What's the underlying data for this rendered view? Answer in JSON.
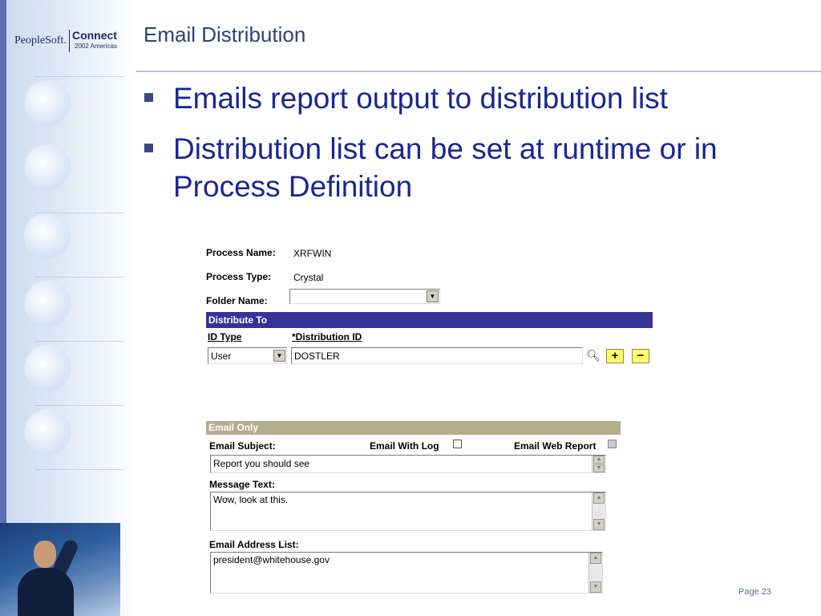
{
  "header": {
    "logo_brand": "PeopleSoft.",
    "logo_product": "Connect",
    "logo_sub": "2002 Americas",
    "title": "Email Distribution"
  },
  "bullets": [
    "Emails report output to distribution list",
    "Distribution list can be set at runtime or in Process Definition"
  ],
  "form": {
    "process_name_label": "Process Name:",
    "process_name_value": "XRFWIN",
    "process_type_label": "Process Type:",
    "process_type_value": "Crystal",
    "folder_name_label": "Folder Name:",
    "folder_name_value": "",
    "distribute_to": {
      "title": "Distribute To",
      "title_bg": "#333399",
      "col_id_type": "ID Type",
      "col_distribution_id": "*Distribution ID",
      "id_type_value": "User",
      "distribution_id_value": "DOSTLER",
      "add_label": "+",
      "remove_label": "−"
    },
    "email_only": {
      "title": "Email Only",
      "title_bg": "#b3ad8c",
      "email_subject_label": "Email Subject:",
      "email_with_log_label": "Email With Log",
      "email_with_log_checked": false,
      "email_web_report_label": "Email Web Report",
      "email_web_report_checked": false,
      "email_web_report_disabled": true,
      "email_subject_value": "Report you should see",
      "message_text_label": "Message Text:",
      "message_text_value": "Wow, look at this.",
      "email_address_list_label": "Email Address List:",
      "email_address_list_value": "president@whitehouse.gov"
    }
  },
  "footer": {
    "page_label": "Page 23"
  },
  "icons": {
    "bullet": "square-bullet-icon",
    "lookup": "magnifier-icon",
    "dropdown": "chevron-down-icon"
  }
}
